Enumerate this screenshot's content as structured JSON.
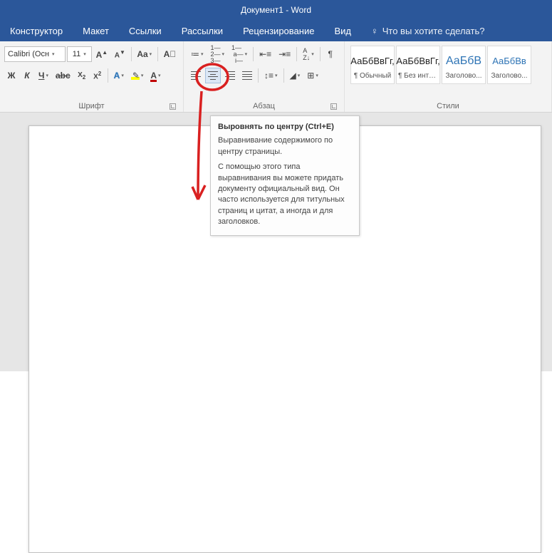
{
  "title": "Документ1  -  Word",
  "tabs": {
    "konstruktor": "Конструктор",
    "maket": "Макет",
    "ssylki": "Ссылки",
    "rassylki": "Рассылки",
    "recenz": "Рецензирование",
    "vid": "Вид",
    "tellme": "Что вы хотите сделать?"
  },
  "font": {
    "name": "Calibri (Осн",
    "size": "11",
    "group_label": "Шрифт"
  },
  "paragraph": {
    "group_label": "Абзац"
  },
  "styles": {
    "group_label": "Стили",
    "items": [
      {
        "preview": "АаБбВвГг,",
        "name": "¶ Обычный"
      },
      {
        "preview": "АаБбВвГг,",
        "name": "¶ Без инте..."
      },
      {
        "preview": "АаБбВ",
        "name": "Заголово..."
      },
      {
        "preview": "АаБбВв",
        "name": "Заголово..."
      }
    ]
  },
  "tooltip": {
    "title": "Выровнять по центру (Ctrl+E)",
    "line1": "Выравнивание содержимого по центру страницы.",
    "line2": "С помощью этого типа выравнивания вы можете придать документу официальный вид. Он часто используется для титульных страниц и цитат, а иногда и для заголовков."
  }
}
